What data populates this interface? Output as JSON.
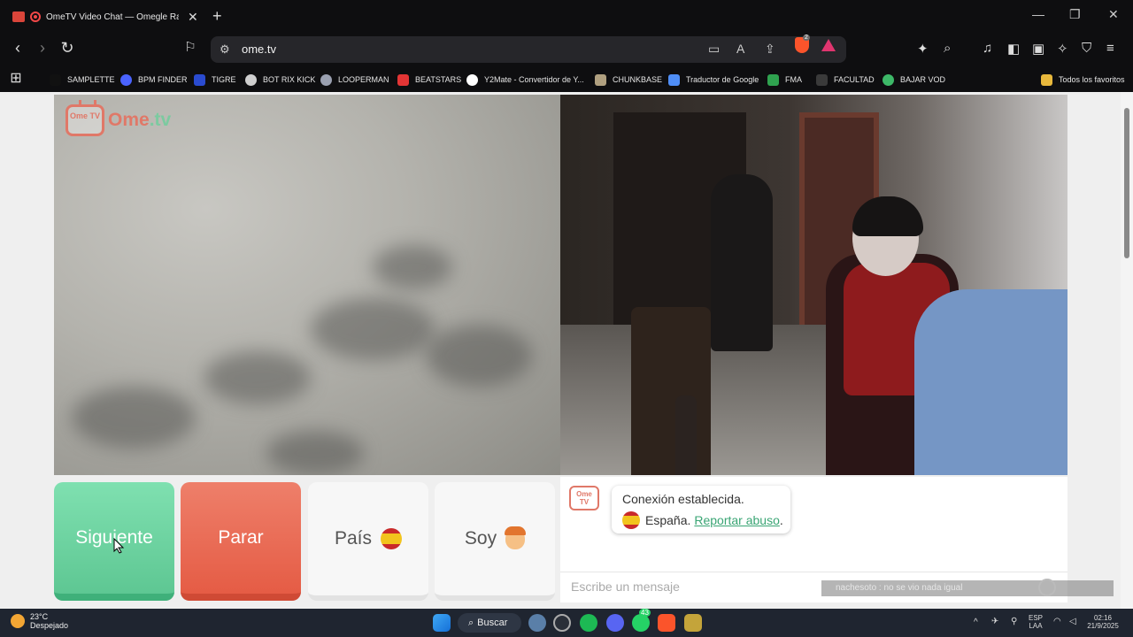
{
  "browser": {
    "tab_title": "OmeTV Video Chat — Omegle Random",
    "new_tab": "+",
    "url": "ome.tv",
    "extensions_badge": "2",
    "win_min": "—",
    "win_max": "❐",
    "win_close": "✕"
  },
  "bookmarks": [
    {
      "label": "SAMPLETTE",
      "color": "#ffffff"
    },
    {
      "label": "BPM FINDER",
      "color": "#4a63ff"
    },
    {
      "label": "TIGRE",
      "color": "#2a4bd0"
    },
    {
      "label": "BOT RIX KICK",
      "color": "#cfcfcf"
    },
    {
      "label": "LOOPERMAN",
      "color": "#9aa0b0"
    },
    {
      "label": "BEATSTARS",
      "color": "#e33535"
    },
    {
      "label": "Y2Mate - Convertidor de Y...",
      "color": "#ffffff"
    },
    {
      "label": "CHUNKBASE",
      "color": "#b0a080"
    },
    {
      "label": "Traductor de Google",
      "color": "#4f8ef7"
    },
    {
      "label": "FMA",
      "color": "#2fa24f"
    },
    {
      "label": "FACULTAD",
      "color": "#3a3a3a"
    },
    {
      "label": "BAJAR VOD",
      "color": "#3db868"
    }
  ],
  "bookmarks_all": "Todos los favoritos",
  "site": {
    "logo_tv": "Ome TV",
    "logo_name": "Ome",
    "logo_dot": ".tv"
  },
  "controls": {
    "next": "Siguiente",
    "stop": "Parar",
    "country": "País",
    "me": "Soy"
  },
  "chat": {
    "badge": "Ome TV",
    "line1": "Conexión establecida.",
    "country": "España.",
    "report": "Reportar abuso",
    "report_suffix": ".",
    "placeholder": "Escribe un mensaje",
    "overlay": "nachesoto : no se vio nada igual"
  },
  "taskbar": {
    "temp": "23°C",
    "weather": "Despejado",
    "search": "Buscar",
    "whatsapp_badge": "43",
    "lang1": "ESP",
    "lang2": "LAA",
    "time": "02:16",
    "date": "21/9/2025"
  }
}
